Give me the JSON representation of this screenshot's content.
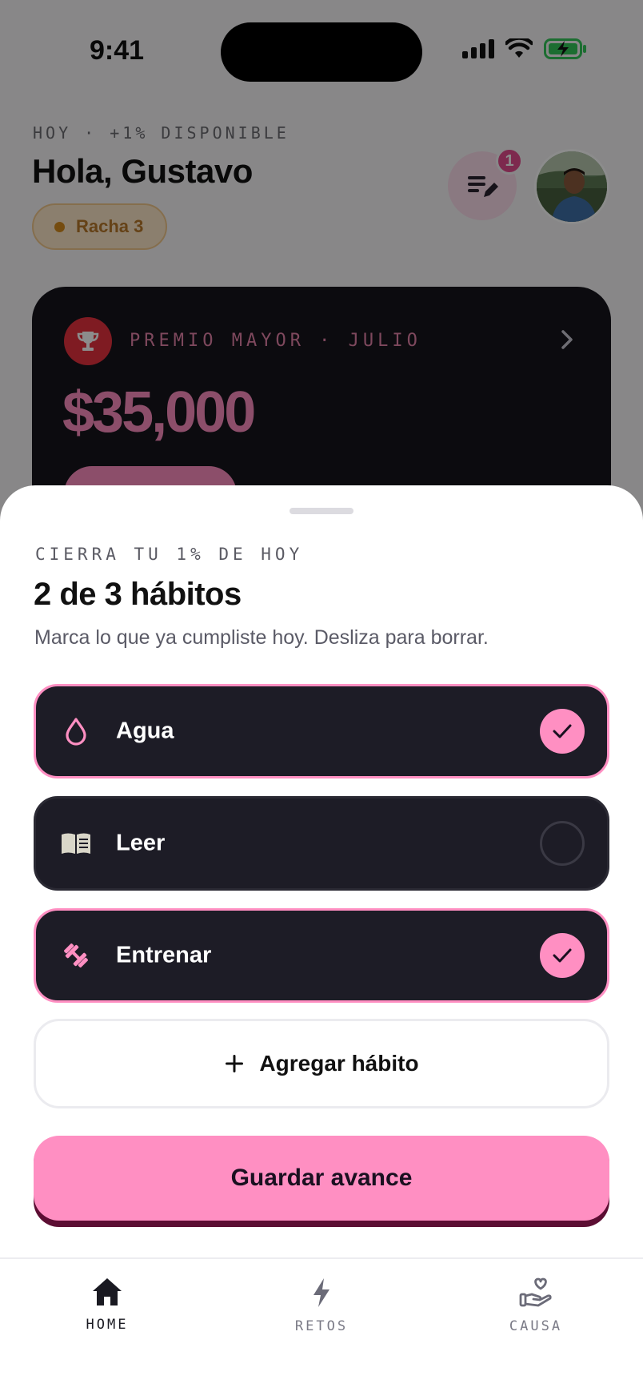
{
  "status": {
    "time": "9:41"
  },
  "header": {
    "kicker": "HOY · +1% DISPONIBLE",
    "greeting": "Hola, Gustavo",
    "streak": "Racha 3",
    "notifications_count": "1"
  },
  "prize": {
    "label": "PREMIO MAYOR · JULIO",
    "amount": "$35,000"
  },
  "sheet": {
    "kicker": "CIERRA TU 1% DE HOY",
    "title": "2 de 3 hábitos",
    "subtitle": "Marca lo que ya cumpliste hoy. Desliza para borrar.",
    "habits": [
      {
        "label": "Agua",
        "icon": "water-drop-icon",
        "done": true
      },
      {
        "label": "Leer",
        "icon": "book-icon",
        "done": false
      },
      {
        "label": "Entrenar",
        "icon": "dumbbell-icon",
        "done": true
      }
    ],
    "add_label": "Agregar hábito",
    "save_label": "Guardar avance"
  },
  "tabs": [
    {
      "label": "HOME",
      "icon": "home-icon",
      "active": true
    },
    {
      "label": "RETOS",
      "icon": "bolt-icon",
      "active": false
    },
    {
      "label": "CAUSA",
      "icon": "heart-hand-icon",
      "active": false
    }
  ],
  "colors": {
    "accent": "#ff8fc2",
    "card_dark": "#1d1c26",
    "streak_bg": "#fde7c8",
    "trophy_red": "#e8323f"
  }
}
